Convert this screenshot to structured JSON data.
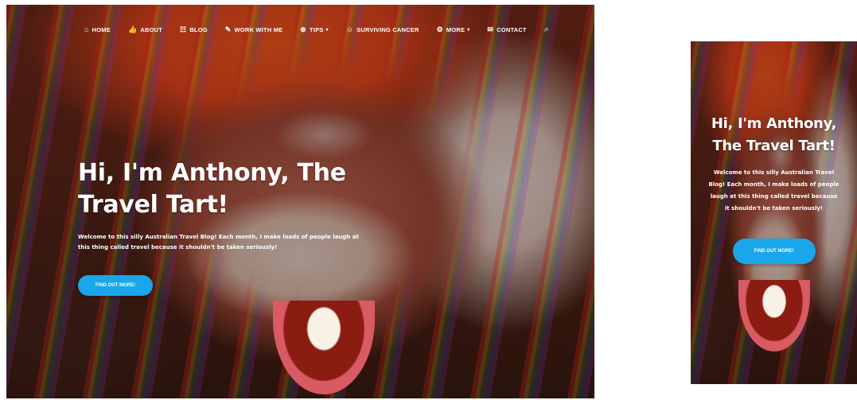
{
  "nav": {
    "items": [
      {
        "label": "HOME",
        "icon": "⌂",
        "caret": ""
      },
      {
        "label": "ABOUT",
        "icon": "👍",
        "caret": ""
      },
      {
        "label": "BLOG",
        "icon": "☷",
        "caret": ""
      },
      {
        "label": "WORK WITH ME",
        "icon": "✎",
        "caret": ""
      },
      {
        "label": "TIPS",
        "icon": "⊕",
        "caret": "▾"
      },
      {
        "label": "SURVIVING CANCER",
        "icon": "☺",
        "caret": ""
      },
      {
        "label": "MORE",
        "icon": "⚙",
        "caret": "▾"
      },
      {
        "label": "CONTACT",
        "icon": "✉",
        "caret": ""
      }
    ],
    "search_icon": "⌕"
  },
  "hero": {
    "title": "Hi, I'm Anthony, The Travel Tart!",
    "text": "Welcome to this silly Australian Travel Blog! Each month, I make loads of people laugh at this thing called travel because it shouldn't be taken seriously!",
    "button_label": "FIND OUT MORE!"
  },
  "colors": {
    "accent": "#1aa6ea",
    "text": "#ffffff"
  }
}
